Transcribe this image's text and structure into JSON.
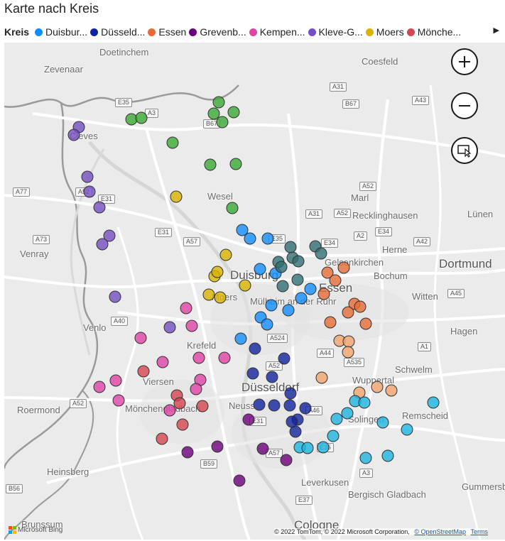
{
  "title": "Karte nach Kreis",
  "legend": {
    "title": "Kreis",
    "items": [
      {
        "label": "Duisbur...",
        "color": "#118DFF"
      },
      {
        "label": "Düsseld...",
        "color": "#12239E"
      },
      {
        "label": "Essen",
        "color": "#E66C37"
      },
      {
        "label": "Grevenb...",
        "color": "#6B007B"
      },
      {
        "label": "Kempen...",
        "color": "#E044A7"
      },
      {
        "label": "Kleve-G...",
        "color": "#744EC2"
      },
      {
        "label": "Moers",
        "color": "#D9B300"
      },
      {
        "label": "Mönche...",
        "color": "#D64550"
      }
    ],
    "next_icon": "chevron-right-icon"
  },
  "map": {
    "places": [
      {
        "label": "Doetinchem"
      },
      {
        "label": "Zevenaar"
      },
      {
        "label": "Coesfeld"
      },
      {
        "label": "Cleves"
      },
      {
        "label": "Wesel"
      },
      {
        "label": "Marl"
      },
      {
        "label": "Recklinghausen"
      },
      {
        "label": "Lünen"
      },
      {
        "label": "Venray"
      },
      {
        "label": "Herne"
      },
      {
        "label": "Gelsenkirchen"
      },
      {
        "label": "Bochum"
      },
      {
        "label": "Dortmund"
      },
      {
        "label": "Duisburg"
      },
      {
        "label": "Essen"
      },
      {
        "label": "Mülheim an der Ruhr"
      },
      {
        "label": "Moers"
      },
      {
        "label": "Witten"
      },
      {
        "label": "Venlo"
      },
      {
        "label": "Hagen"
      },
      {
        "label": "Krefeld"
      },
      {
        "label": "Schwelm"
      },
      {
        "label": "Wuppertal"
      },
      {
        "label": "Viersen"
      },
      {
        "label": "Düsseldorf"
      },
      {
        "label": "Roermond"
      },
      {
        "label": "Mönchengladbach"
      },
      {
        "label": "Neuss"
      },
      {
        "label": "Remscheid"
      },
      {
        "label": "Solingen"
      },
      {
        "label": "Heinsberg"
      },
      {
        "label": "Leverkusen"
      },
      {
        "label": "Bergisch Gladbach"
      },
      {
        "label": "Gummersbach"
      },
      {
        "label": "Brunssum"
      },
      {
        "label": "Cologne"
      }
    ],
    "roads": [
      "E35",
      "A3",
      "B67",
      "A31",
      "B67",
      "A43",
      "A77",
      "A52",
      "E31",
      "A52",
      "A31",
      "A52",
      "A73",
      "E31",
      "A57",
      "E35",
      "E34",
      "A2",
      "E34",
      "A42",
      "A40",
      "A45",
      "A524",
      "A1",
      "A44",
      "A535",
      "A52",
      "E31",
      "A57",
      "B59",
      "E35",
      "E37",
      "B56",
      "A52",
      "A46",
      "A3"
    ],
    "buttons": {
      "zoom_in": "plus-icon",
      "zoom_out": "minus-icon",
      "select": "lasso-select-icon"
    },
    "logo_text": "Microsoft Bing",
    "attribution": "© 2022 TomTom, © 2022 Microsoft Corporation,",
    "osm_link": "© OpenStreetMap",
    "terms_link": "Terms",
    "points": [
      {
        "series": "Grün",
        "color": "#3AAA35",
        "coords": [
          [
            308,
            144
          ],
          [
            301,
            160
          ],
          [
            329,
            158
          ],
          [
            313,
            172
          ],
          [
            185,
            168
          ],
          [
            199,
            166
          ],
          [
            243,
            201
          ],
          [
            296,
            232
          ],
          [
            332,
            231
          ],
          [
            327,
            293
          ]
        ]
      },
      {
        "series": "Kleve-G...",
        "color": "#744EC2",
        "coords": [
          [
            111,
            179
          ],
          [
            104,
            190
          ],
          [
            123,
            249
          ],
          [
            126,
            270
          ],
          [
            140,
            292
          ],
          [
            154,
            332
          ],
          [
            144,
            344
          ],
          [
            162,
            418
          ],
          [
            239,
            461
          ]
        ]
      },
      {
        "series": "Moers",
        "color": "#D9B300",
        "coords": [
          [
            248,
            277
          ],
          [
            318,
            359
          ],
          [
            302,
            389
          ],
          [
            306,
            383
          ],
          [
            345,
            402
          ],
          [
            294,
            415
          ],
          [
            310,
            419
          ]
        ]
      },
      {
        "series": "Duisbur...",
        "color": "#118DFF",
        "coords": [
          [
            341,
            324
          ],
          [
            352,
            336
          ],
          [
            377,
            336
          ],
          [
            366,
            379
          ],
          [
            388,
            385
          ],
          [
            437,
            407
          ],
          [
            424,
            420
          ],
          [
            382,
            430
          ],
          [
            406,
            437
          ],
          [
            367,
            447
          ],
          [
            376,
            457
          ],
          [
            339,
            477
          ]
        ]
      },
      {
        "series": "Teal",
        "color": "#2F6F73",
        "coords": [
          [
            409,
            348
          ],
          [
            412,
            363
          ],
          [
            392,
            369
          ],
          [
            420,
            368
          ],
          [
            396,
            376
          ],
          [
            444,
            347
          ],
          [
            452,
            357
          ],
          [
            419,
            394
          ],
          [
            398,
            403
          ]
        ]
      },
      {
        "series": "Essen",
        "color": "#E66C37",
        "coords": [
          [
            484,
            377
          ],
          [
            461,
            384
          ],
          [
            472,
            395
          ],
          [
            456,
            414
          ],
          [
            499,
            428
          ],
          [
            507,
            432
          ],
          [
            490,
            440
          ],
          [
            465,
            454
          ],
          [
            515,
            456
          ]
        ]
      },
      {
        "series": "Wuppertal",
        "color": "#F3A56B",
        "coords": [
          [
            478,
            480
          ],
          [
            491,
            481
          ],
          [
            490,
            496
          ],
          [
            453,
            532
          ],
          [
            531,
            545
          ],
          [
            551,
            550
          ],
          [
            506,
            553
          ]
        ]
      },
      {
        "series": "Kempen...",
        "color": "#E044A7",
        "coords": [
          [
            262,
            434
          ],
          [
            270,
            459
          ],
          [
            198,
            476
          ],
          [
            229,
            510
          ],
          [
            280,
            504
          ],
          [
            316,
            504
          ],
          [
            163,
            536
          ],
          [
            140,
            545
          ],
          [
            282,
            535
          ],
          [
            276,
            548
          ],
          [
            167,
            564
          ],
          [
            239,
            578
          ]
        ]
      },
      {
        "series": "Mönche...",
        "color": "#D64550",
        "coords": [
          [
            202,
            523
          ],
          [
            249,
            557
          ],
          [
            253,
            568
          ],
          [
            285,
            572
          ],
          [
            257,
            598
          ],
          [
            228,
            618
          ]
        ]
      },
      {
        "series": "Düsseld...",
        "color": "#12239E",
        "coords": [
          [
            359,
            491
          ],
          [
            400,
            505
          ],
          [
            356,
            526
          ],
          [
            383,
            531
          ],
          [
            409,
            554
          ],
          [
            365,
            570
          ],
          [
            386,
            571
          ],
          [
            408,
            571
          ],
          [
            430,
            575
          ],
          [
            419,
            591
          ],
          [
            411,
            594
          ],
          [
            416,
            608
          ]
        ]
      },
      {
        "series": "Grevenb...",
        "color": "#6B007B",
        "coords": [
          [
            350,
            591
          ],
          [
            306,
            629
          ],
          [
            264,
            637
          ],
          [
            370,
            632
          ],
          [
            403,
            648
          ],
          [
            337,
            677
          ]
        ]
      },
      {
        "series": "Solingen",
        "color": "#1CB5E0",
        "coords": [
          [
            500,
            565
          ],
          [
            513,
            567
          ],
          [
            489,
            582
          ],
          [
            474,
            590
          ],
          [
            539,
            595
          ],
          [
            573,
            605
          ],
          [
            610,
            567
          ],
          [
            469,
            614
          ],
          [
            422,
            630
          ],
          [
            433,
            631
          ],
          [
            455,
            630
          ],
          [
            515,
            645
          ],
          [
            546,
            642
          ]
        ]
      }
    ]
  }
}
